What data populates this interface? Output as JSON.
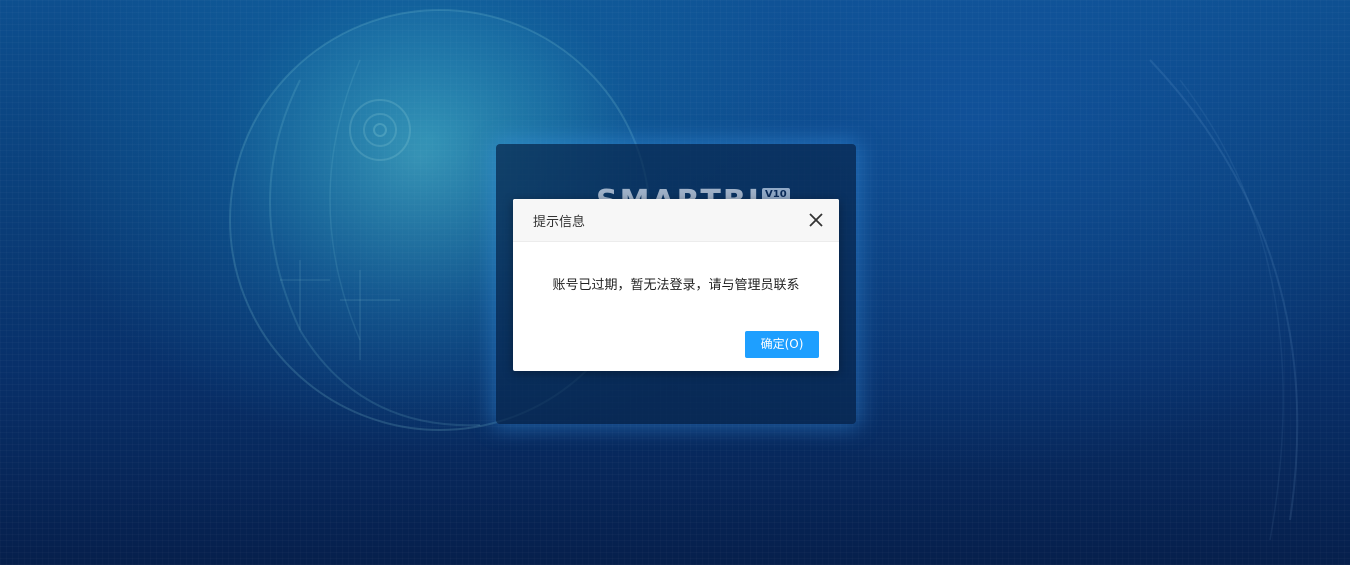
{
  "background": {
    "logo_text": "SMARTBI",
    "logo_version": "V10"
  },
  "dialog": {
    "title": "提示信息",
    "close_icon": "close-icon",
    "message": "账号已过期，暂无法登录，请与管理员联系",
    "confirm_label": "确定(O)"
  },
  "colors": {
    "confirm_button": "#1e9fff",
    "dialog_header": "#f7f7f7",
    "background_dark": "#061f4c",
    "background_light": "#0d4f8f"
  }
}
